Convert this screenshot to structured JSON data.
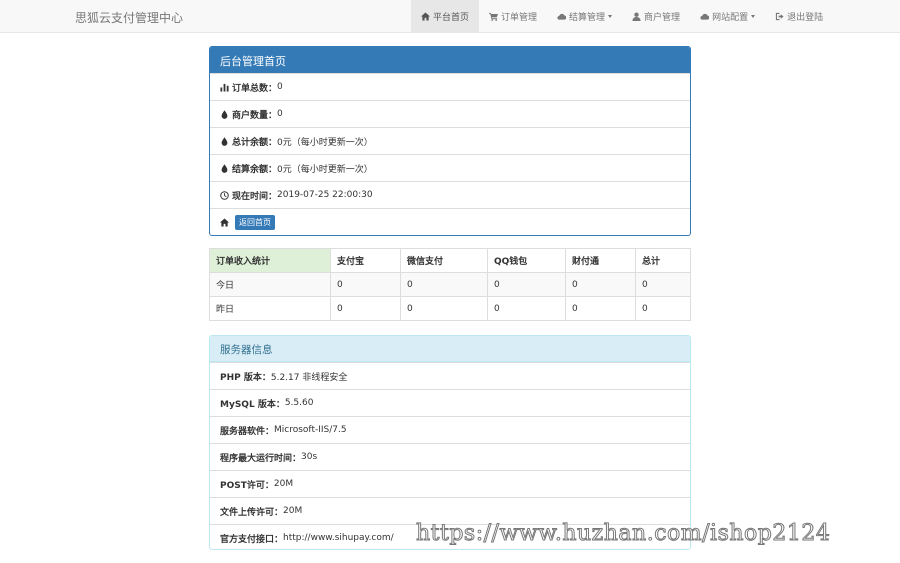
{
  "navbar": {
    "brand": "思狐云支付管理中心",
    "items": [
      {
        "label": "平台首页",
        "icon": "home-icon",
        "active": true
      },
      {
        "label": "订单管理",
        "icon": "cart-icon"
      },
      {
        "label": "结算管理",
        "icon": "cloud-icon",
        "dropdown": true
      },
      {
        "label": "商户管理",
        "icon": "user-icon"
      },
      {
        "label": "网站配置",
        "icon": "cloud-icon",
        "dropdown": true
      },
      {
        "label": "退出登陆",
        "icon": "logout-icon"
      }
    ]
  },
  "summary": {
    "title": "后台管理首页",
    "order_total_label": "订单总数：",
    "order_total_value": "0",
    "merchant_count_label": "商户数量：",
    "merchant_count_value": "0",
    "total_balance_label": "总计余额：",
    "total_balance_value": "0元（每小时更新一次）",
    "settle_balance_label": "结算余额：",
    "settle_balance_value": "0元（每小时更新一次）",
    "now_time_label": "现在时间：",
    "now_time_value": " 2019-07-25 22:00:30",
    "back_home": "返回首页"
  },
  "stats": {
    "headers": [
      "订单收入统计",
      "支付宝",
      "微信支付",
      "QQ钱包",
      "财付通",
      "总计"
    ],
    "rows": [
      [
        "今日",
        "0",
        "0",
        "0",
        "0",
        "0"
      ],
      [
        "昨日",
        "0",
        "0",
        "0",
        "0",
        "0"
      ]
    ]
  },
  "server": {
    "title": "服务器信息",
    "php_label": "PHP 版本：",
    "php_value": "5.2.17 非线程安全",
    "mysql_label": "MySQL 版本：",
    "mysql_value": "5.5.60",
    "software_label": "服务器软件：",
    "software_value": "Microsoft-IIS/7.5",
    "maxtime_label": "程序最大运行时间：",
    "maxtime_value": "30s",
    "post_label": "POST许可：",
    "post_value": "20M",
    "upload_label": "文件上传许可：",
    "upload_value": "20M",
    "api_label": "官方支付接口：",
    "api_value": "http://www.sihupay.com/"
  },
  "watermark": "https://www.huzhan.com/ishop2124"
}
